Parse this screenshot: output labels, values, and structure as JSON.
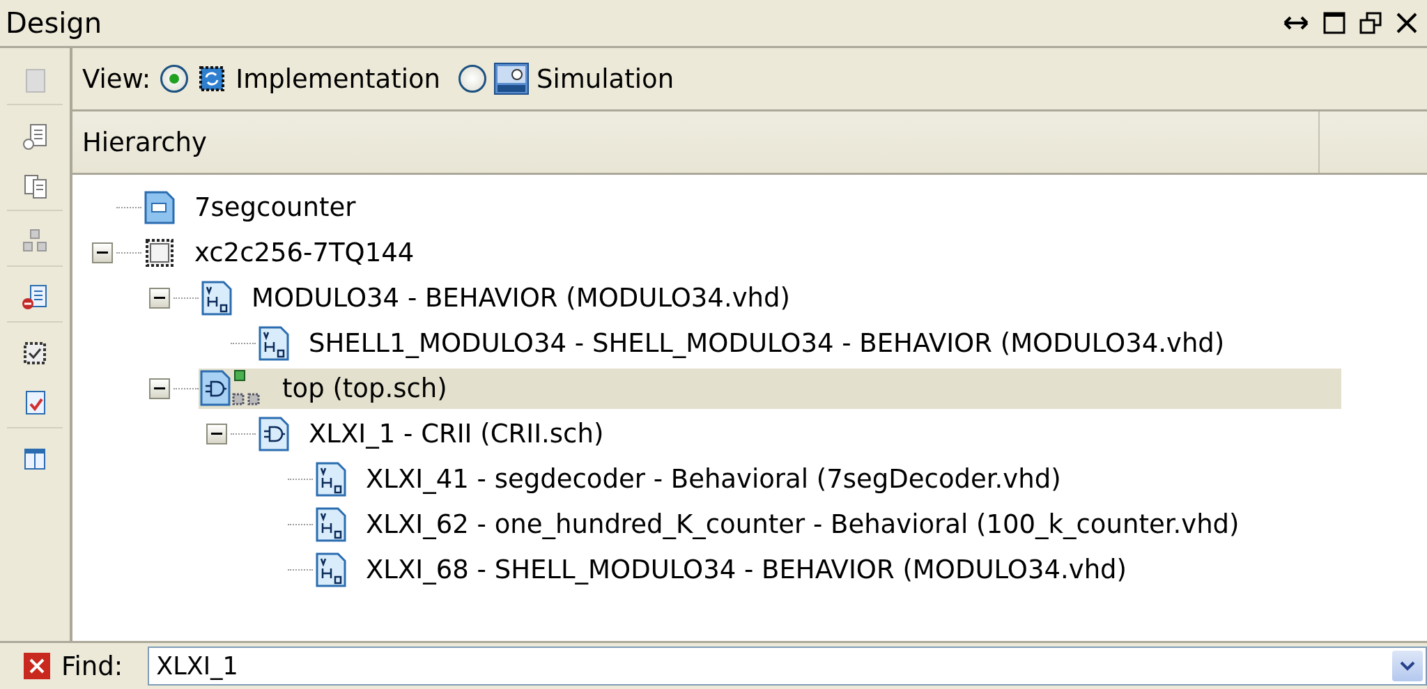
{
  "panel": {
    "title": "Design"
  },
  "view": {
    "label": "View:",
    "options": [
      {
        "label": "Implementation",
        "kind": "implementation",
        "selected": true
      },
      {
        "label": "Simulation",
        "kind": "simulation",
        "selected": false
      }
    ]
  },
  "hierarchy": {
    "header": "Hierarchy",
    "nodes": [
      {
        "label": "7segcounter",
        "kind": "project",
        "selected": false
      },
      {
        "label": "xc2c256-7TQ144",
        "kind": "chip",
        "selected": false,
        "expanded": true,
        "children": [
          {
            "label": "MODULO34 - BEHAVIOR (MODULO34.vhd)",
            "kind": "vhdl",
            "selected": false,
            "expanded": true,
            "children": [
              {
                "label": "SHELL1_MODULO34 - SHELL_MODULO34 - BEHAVIOR (MODULO34.vhd)",
                "kind": "vhdl",
                "selected": false
              }
            ]
          },
          {
            "label": "top (top.sch)",
            "kind": "top-schematic",
            "selected": true,
            "expanded": true,
            "children": [
              {
                "label": "XLXI_1 - CRII (CRII.sch)",
                "kind": "schematic",
                "selected": false,
                "expanded": true,
                "children": [
                  {
                    "label": "XLXI_41 - segdecoder - Behavioral (7segDecoder.vhd)",
                    "kind": "vhdl",
                    "selected": false
                  },
                  {
                    "label": "XLXI_62 - one_hundred_K_counter - Behavioral (100_k_counter.vhd)",
                    "kind": "vhdl",
                    "selected": false
                  },
                  {
                    "label": "XLXI_68 - SHELL_MODULO34 - BEHAVIOR (MODULO34.vhd)",
                    "kind": "vhdl",
                    "selected": false
                  }
                ]
              }
            ]
          }
        ]
      }
    ]
  },
  "find": {
    "label": "Find:",
    "value": "XLXI_1"
  }
}
